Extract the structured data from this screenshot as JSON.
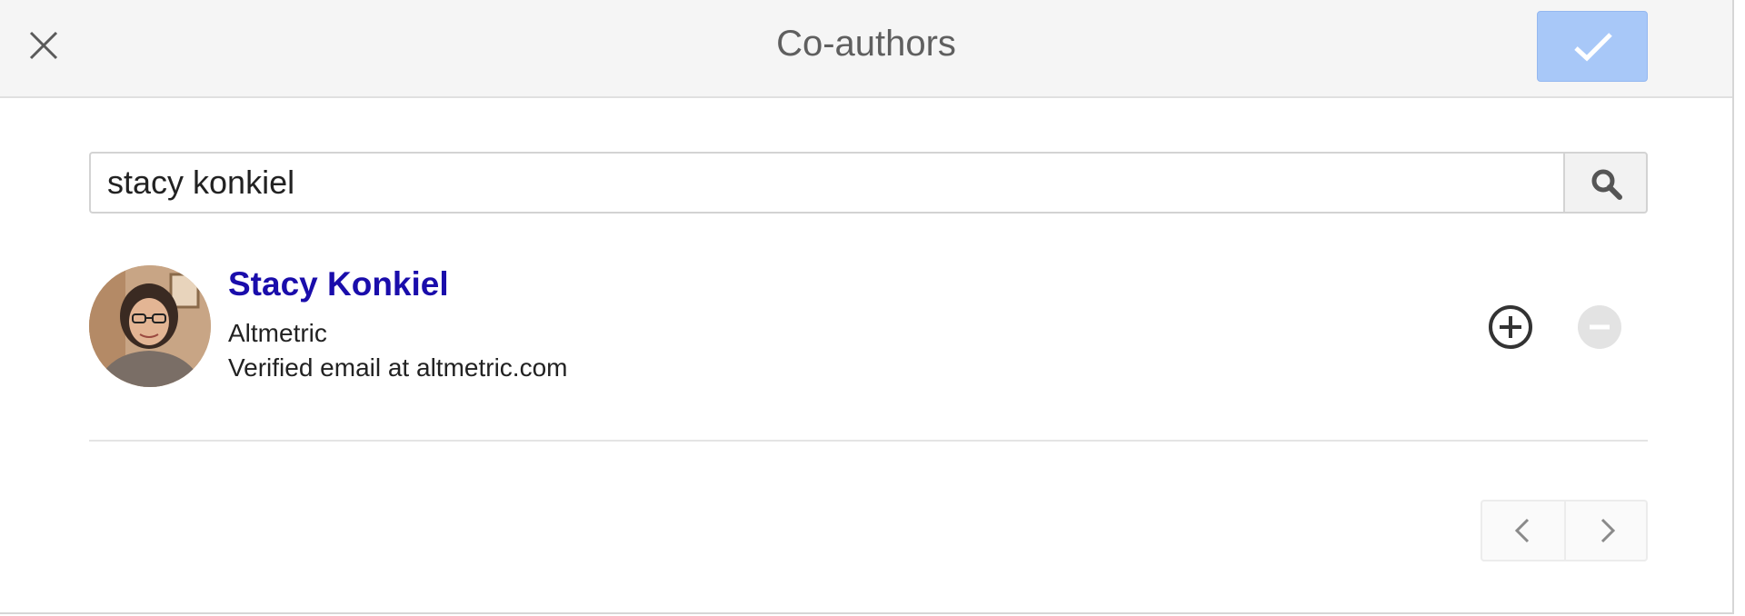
{
  "dialog": {
    "title": "Co-authors",
    "close_icon": "close-icon",
    "confirm_icon": "checkmark-icon"
  },
  "search": {
    "value": "stacy konkiel",
    "icon": "search-icon"
  },
  "results": [
    {
      "name": "Stacy Konkiel",
      "affiliation": "Altmetric",
      "email_note": "Verified email at altmetric.com",
      "add_icon": "plus-circle-icon",
      "remove_icon": "minus-circle-icon"
    }
  ],
  "pagination": {
    "prev_icon": "chevron-left-icon",
    "next_icon": "chevron-right-icon"
  },
  "colors": {
    "header_bg": "#f5f5f5",
    "confirm_button_disabled": "#a8c8f8",
    "author_link": "#1a0dab",
    "title_text": "#5f5f5f"
  }
}
